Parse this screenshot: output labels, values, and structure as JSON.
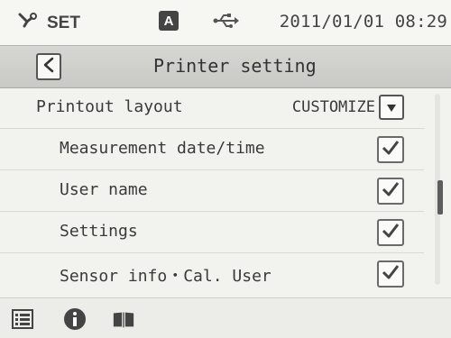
{
  "status": {
    "mode_label": "SET",
    "mode_icon": "wrench-icon",
    "indicator_letter": "A",
    "usb_icon": "usb-icon",
    "datetime": "2011/01/01 08:29"
  },
  "header": {
    "back_icon": "chevron-left-icon",
    "title": "Printer setting"
  },
  "settings": {
    "layout": {
      "label": "Printout layout",
      "value": "CUSTOMIZE"
    },
    "items": [
      {
        "label": "Measurement date/time",
        "checked": true
      },
      {
        "label": "User name",
        "checked": true
      },
      {
        "label": "Settings",
        "checked": true
      },
      {
        "label": "Sensor info・Cal. User",
        "checked": true
      }
    ]
  },
  "scroll": {
    "position_fraction": 0.45
  },
  "toolbar": {
    "icons": [
      "list-icon",
      "info-icon",
      "book-icon"
    ]
  },
  "colors": {
    "titlebar": "#cfcfcc",
    "text": "#3a3a3a",
    "background": "#f2f2ee"
  }
}
